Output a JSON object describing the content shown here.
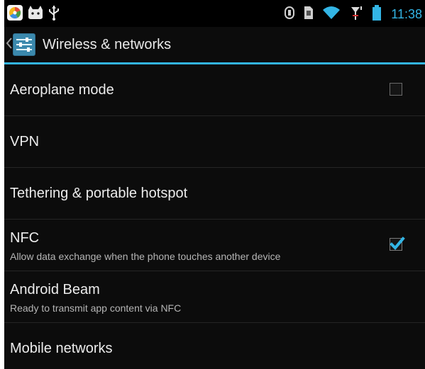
{
  "status_bar": {
    "time": "11:38",
    "icons_left": [
      "app-color-icon",
      "cat-icon",
      "usb-icon"
    ],
    "icons_right": [
      "sync-icon",
      "sim-icon",
      "wifi-icon",
      "signal-icon",
      "battery-icon"
    ]
  },
  "action_bar": {
    "title": "Wireless & networks",
    "back_icon": "chevron-left-icon",
    "app_icon": "settings-sliders-icon"
  },
  "settings": [
    {
      "title": "Aeroplane mode",
      "summary": "",
      "checkbox": true,
      "checked": false
    },
    {
      "title": "VPN",
      "summary": "",
      "checkbox": false
    },
    {
      "title": "Tethering & portable hotspot",
      "summary": "",
      "checkbox": false
    },
    {
      "title": "NFC",
      "summary": "Allow data exchange when the phone touches another device",
      "checkbox": true,
      "checked": true
    },
    {
      "title": "Android Beam",
      "summary": "Ready to transmit app content via NFC",
      "checkbox": false
    },
    {
      "title": "Mobile networks",
      "summary": "",
      "checkbox": false
    }
  ],
  "colors": {
    "accent": "#33b5e5",
    "background": "#0c0c0c",
    "text_primary": "#ececec",
    "text_secondary": "#b5b5b5"
  }
}
